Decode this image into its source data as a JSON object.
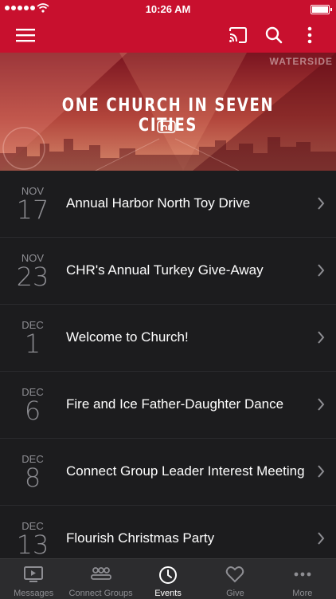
{
  "status_bar": {
    "time": "10:26 AM"
  },
  "banner": {
    "title": "ONE CHURCH IN SEVEN CITIES",
    "sign_text": "WATERSIDE"
  },
  "events": [
    {
      "month": "NOV",
      "day": "17",
      "title": "Annual Harbor North Toy Drive"
    },
    {
      "month": "NOV",
      "day": "23",
      "title": "CHR's Annual Turkey Give-Away"
    },
    {
      "month": "DEC",
      "day": "1",
      "title": "Welcome to Church!"
    },
    {
      "month": "DEC",
      "day": "6",
      "title": "Fire and Ice Father-Daughter Dance"
    },
    {
      "month": "DEC",
      "day": "8",
      "title": "Connect Group Leader Interest Meeting"
    },
    {
      "month": "DEC",
      "day": "13",
      "title": "Flourish Christmas Party"
    }
  ],
  "tabs": [
    {
      "label": "Messages",
      "icon": "tv-icon"
    },
    {
      "label": "Connect Groups",
      "icon": "group-icon"
    },
    {
      "label": "Events",
      "icon": "clock-icon",
      "active": true
    },
    {
      "label": "Give",
      "icon": "heart-icon"
    },
    {
      "label": "More",
      "icon": "more-dots-icon"
    }
  ],
  "colors": {
    "brand": "#c8102e",
    "background": "#1c1c1e",
    "tabbar": "#2c2c2e",
    "muted": "#8e8e93"
  }
}
